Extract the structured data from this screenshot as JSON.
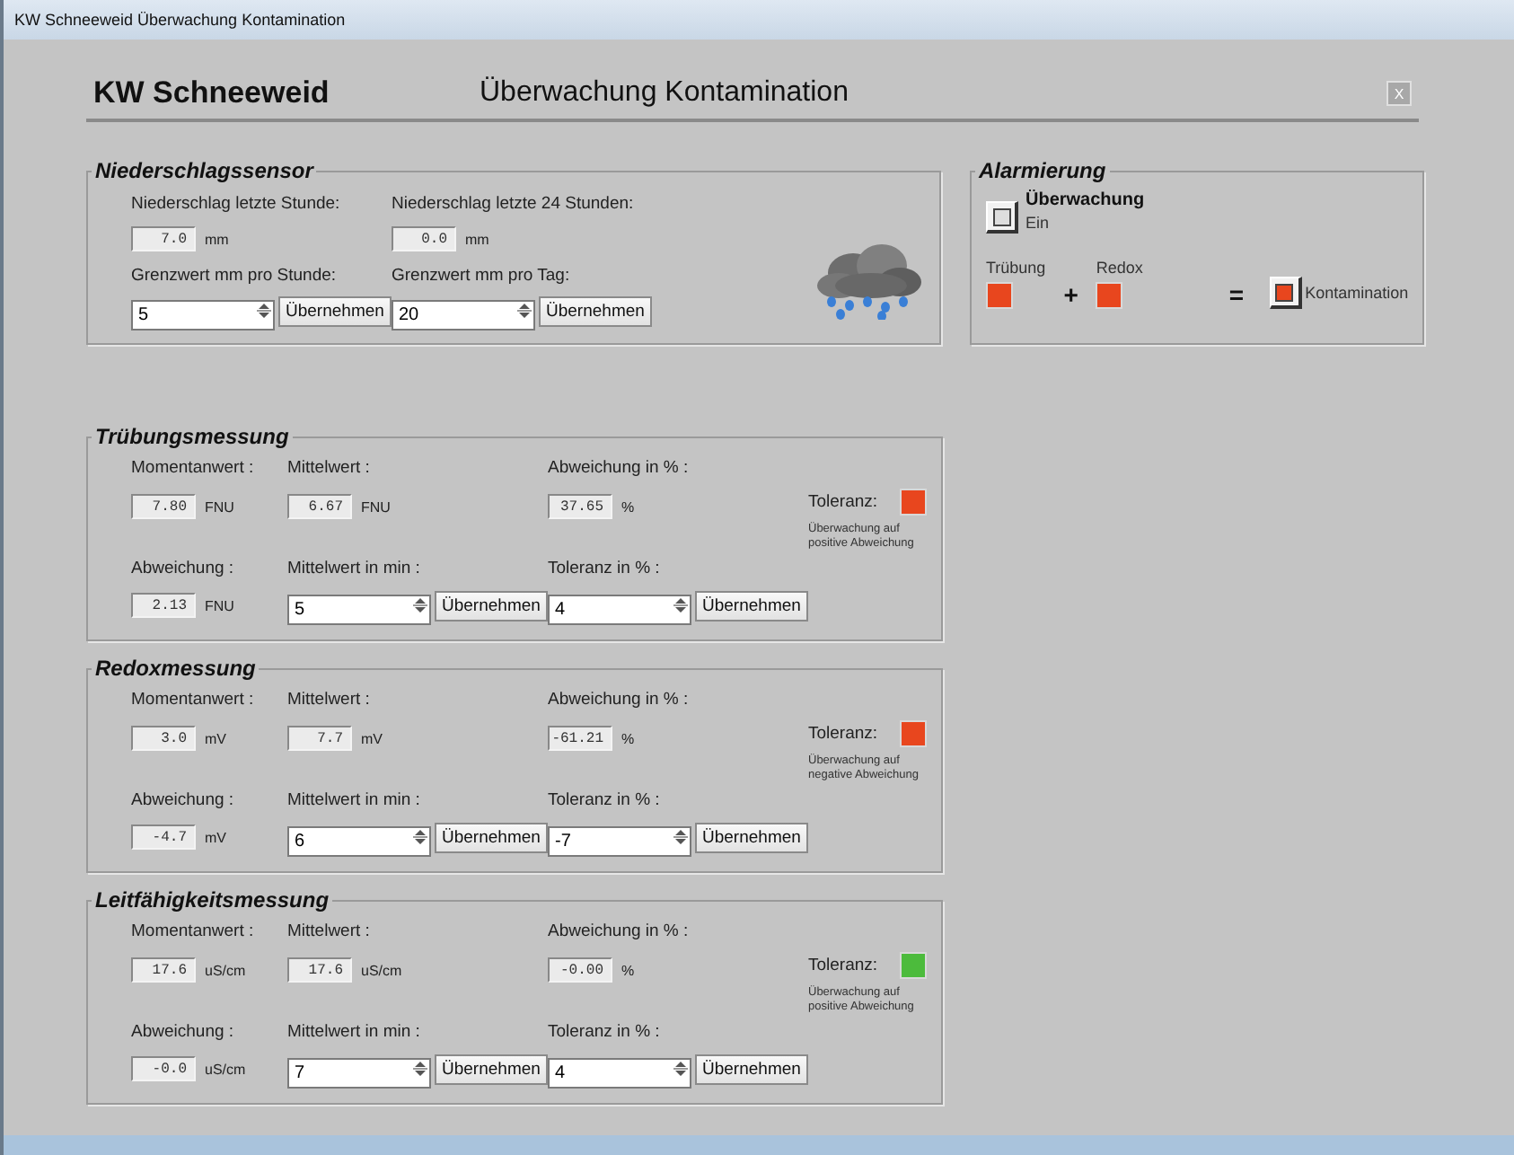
{
  "window": {
    "title": "KW Schneeweid Überwachung Kontamination"
  },
  "header": {
    "brand": "KW Schneeweid",
    "title": "Überwachung Kontamination",
    "close": "X"
  },
  "precipitation": {
    "title": "Niederschlagssensor",
    "readings": [
      {
        "label": "Niederschlag letzte Stunde:",
        "value": "7.0",
        "unit": "mm"
      },
      {
        "label": "Niederschlag letzte 24 Stunden:",
        "value": "0.0",
        "unit": "mm"
      }
    ],
    "limits": [
      {
        "label": "Grenzwert mm pro Stunde:",
        "value": "5",
        "button": "Übernehmen"
      },
      {
        "label": "Grenzwert mm pro Tag:",
        "value": "20",
        "button": "Übernehmen"
      }
    ]
  },
  "alarm": {
    "title": "Alarmierung",
    "monitor": {
      "label": "Überwachung",
      "state": "Ein"
    },
    "inputs": [
      {
        "label": "Trübung",
        "color": "#e8461e"
      },
      {
        "label": "Redox",
        "color": "#e8461e"
      }
    ],
    "plus": "+",
    "equals": "=",
    "result": {
      "label": "Kontamination",
      "color": "#e8461e"
    }
  },
  "measurements": [
    {
      "title": "Trübungsmessung",
      "current": {
        "label": "Momentanwert :",
        "value": "7.80",
        "unit": "FNU"
      },
      "mean": {
        "label": "Mittelwert :",
        "value": "6.67",
        "unit": "FNU"
      },
      "deviation_pct": {
        "label": "Abweichung in % :",
        "value": "37.65",
        "unit": "%"
      },
      "deviation": {
        "label": "Abweichung :",
        "value": "2.13",
        "unit": "FNU"
      },
      "mean_minutes": {
        "label": "Mittelwert in min :",
        "value": "5",
        "button": "Übernehmen"
      },
      "tolerance_pct": {
        "label": "Toleranz in % :",
        "value": "4",
        "button": "Übernehmen"
      },
      "tolerance": {
        "label": "Toleranz:",
        "color": "#e8461e"
      },
      "note": "Überwachung auf positive Abweichung"
    },
    {
      "title": "Redoxmessung",
      "current": {
        "label": "Momentanwert :",
        "value": "3.0",
        "unit": "mV"
      },
      "mean": {
        "label": "Mittelwert :",
        "value": "7.7",
        "unit": "mV"
      },
      "deviation_pct": {
        "label": "Abweichung in % :",
        "value": "-61.21",
        "unit": "%"
      },
      "deviation": {
        "label": "Abweichung :",
        "value": "-4.7",
        "unit": "mV"
      },
      "mean_minutes": {
        "label": "Mittelwert in min :",
        "value": "6",
        "button": "Übernehmen"
      },
      "tolerance_pct": {
        "label": "Toleranz in % :",
        "value": "-7",
        "button": "Übernehmen"
      },
      "tolerance": {
        "label": "Toleranz:",
        "color": "#e8461e"
      },
      "note": "Überwachung auf negative Abweichung"
    },
    {
      "title": "Leitfähigkeitsmessung",
      "current": {
        "label": "Momentanwert :",
        "value": "17.6",
        "unit": "uS/cm"
      },
      "mean": {
        "label": "Mittelwert :",
        "value": "17.6",
        "unit": "uS/cm"
      },
      "deviation_pct": {
        "label": "Abweichung in % :",
        "value": "-0.00",
        "unit": "%"
      },
      "deviation": {
        "label": "Abweichung :",
        "value": "-0.0",
        "unit": "uS/cm"
      },
      "mean_minutes": {
        "label": "Mittelwert in min :",
        "value": "7",
        "button": "Übernehmen"
      },
      "tolerance_pct": {
        "label": "Toleranz in % :",
        "value": "4",
        "button": "Übernehmen"
      },
      "tolerance": {
        "label": "Toleranz:",
        "color": "#4cbb3c"
      },
      "note": "Überwachung auf positive Abweichung"
    }
  ]
}
